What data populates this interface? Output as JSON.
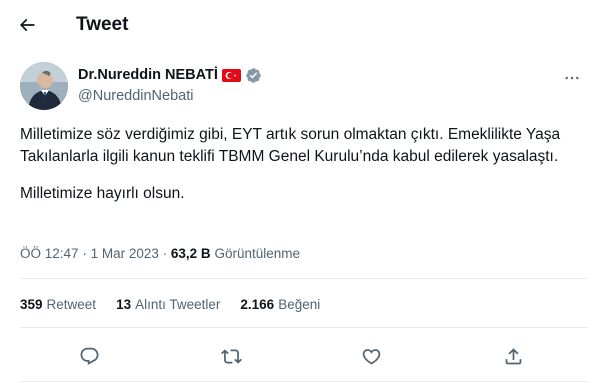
{
  "header": {
    "title": "Tweet",
    "back_icon": "arrow-left-icon"
  },
  "author": {
    "name": "Dr.Nureddin NEBATİ",
    "handle": "@NureddinNebati",
    "flag_icon": "turkey-flag-icon",
    "verified_icon": "verified-badge-icon",
    "more_icon": "more-horizontal-icon"
  },
  "tweet": {
    "paragraph_1": "Milletimize söz verdiğimiz gibi, EYT artık sorun olmaktan çıktı. Emeklilikte Yaşa Takılanlarla ilgili kanun teklifi TBMM Genel Kurulu’nda kabul edilerek yasalaştı.",
    "paragraph_2": "Milletimize hayırlı olsun."
  },
  "meta": {
    "time": "ÖÖ 12:47",
    "separator": "·",
    "date": "1 Mar 2023",
    "views_count": "63,2 B",
    "views_label": "Görüntülenme"
  },
  "stats": {
    "retweets_count": "359",
    "retweets_label": "Retweet",
    "quotes_count": "13",
    "quotes_label": "Alıntı Tweetler",
    "likes_count": "2.166",
    "likes_label": "Beğeni"
  },
  "actions": {
    "reply_icon": "reply-icon",
    "retweet_icon": "retweet-icon",
    "like_icon": "heart-icon",
    "share_icon": "share-icon"
  },
  "colors": {
    "text": "#0f1419",
    "secondary": "#536471",
    "divider": "#e6ecf0",
    "verified": "#1d9bf0",
    "flag_red": "#e30a17"
  }
}
